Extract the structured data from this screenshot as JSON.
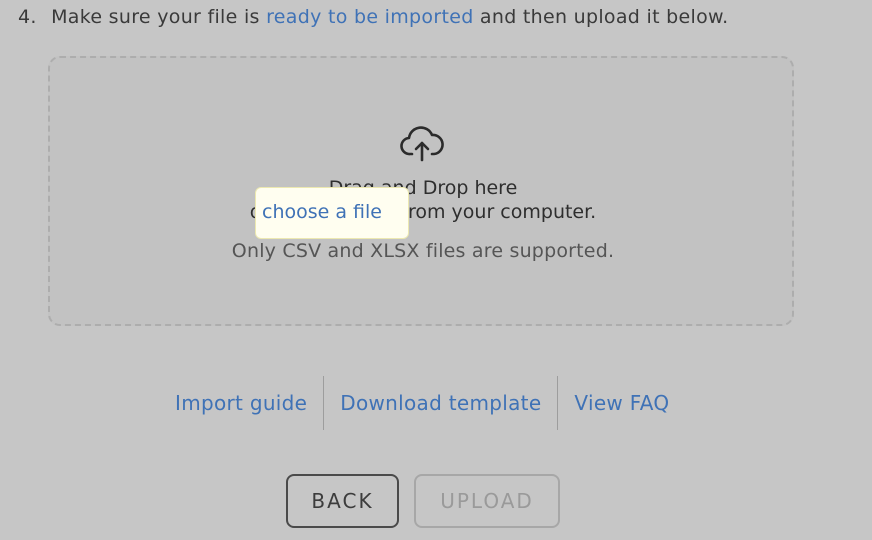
{
  "instruction": {
    "number": "4.",
    "text_before": "Make sure your file is",
    "link_text": "ready to be imported",
    "text_after": "and then upload it below."
  },
  "dropzone": {
    "icon": "cloud-upload-icon",
    "drag_text": "Drag and Drop here",
    "choose_prefix": "or",
    "choose_link": "choose a file",
    "choose_suffix": "from your computer.",
    "supported_text": "Only CSV and XLSX files are supported."
  },
  "help_links": {
    "import_guide": "Import guide",
    "download_template": "Download template",
    "view_faq": "View FAQ"
  },
  "buttons": {
    "back": "BACK",
    "upload": "UPLOAD"
  },
  "colors": {
    "link": "#3f72b6",
    "background": "#c6c6c6"
  }
}
